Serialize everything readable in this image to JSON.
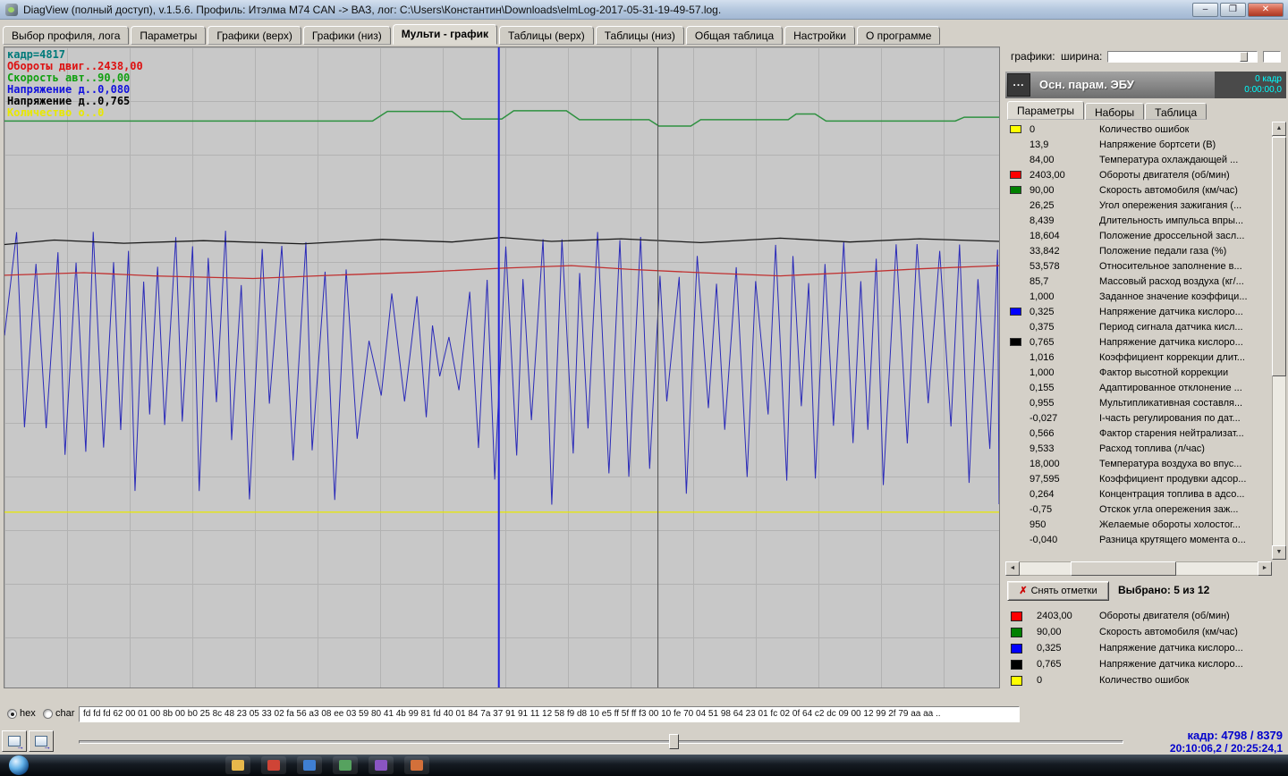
{
  "window": {
    "title": "DiagView (полный доступ), v.1.5.6. Профиль: Итэлма М74 CAN -> ВАЗ,  лог: C:\\Users\\Константин\\Downloads\\elmLog-2017-05-31-19-49-57.log.",
    "controls": {
      "minimize": "–",
      "maximize": "❐",
      "close": "✕"
    }
  },
  "icons": {
    "clear_x": "✗",
    "up": "▲",
    "down": "▼",
    "left": "◄",
    "right": "►"
  },
  "tabs": {
    "active_index": 4,
    "items": [
      "Выбор профиля, лога",
      "Параметры",
      "Графики (верх)",
      "Графики (низ)",
      "Мульти - график",
      "Таблицы (верх)",
      "Таблицы (низ)",
      "Общая таблица",
      "Настройки",
      "О программе"
    ]
  },
  "chart": {
    "legend": [
      {
        "text": "кадр=4817",
        "color": "#007a7a"
      },
      {
        "text": "Обороты двиг..2438,00",
        "color": "#dd1111"
      },
      {
        "text": "Скорость авт..90,00",
        "color": "#11a011"
      },
      {
        "text": "Напряжение д..0,080",
        "color": "#1111dd"
      },
      {
        "text": "Напряжение д..0,765",
        "color": "#000000"
      },
      {
        "text": "Количество о..0",
        "color": "#e8e800"
      }
    ],
    "colors": {
      "blue": "#2a2ab8",
      "red": "#c03030",
      "green": "#2e9140",
      "black": "#1a1a1a",
      "yellow": "#e8e800"
    },
    "series": {
      "green": [
        [
          0,
          0.115
        ],
        [
          0.37,
          0.115
        ],
        [
          0.385,
          0.1
        ],
        [
          0.45,
          0.1
        ],
        [
          0.46,
          0.112
        ],
        [
          0.5,
          0.112
        ],
        [
          0.512,
          0.099
        ],
        [
          0.565,
          0.099
        ],
        [
          0.578,
          0.113
        ],
        [
          0.648,
          0.113
        ],
        [
          0.658,
          0.123
        ],
        [
          0.69,
          0.123
        ],
        [
          0.7,
          0.113
        ],
        [
          0.788,
          0.113
        ],
        [
          0.796,
          0.104
        ],
        [
          0.815,
          0.104
        ],
        [
          0.826,
          0.115
        ],
        [
          0.956,
          0.115
        ],
        [
          0.965,
          0.109
        ],
        [
          1,
          0.109
        ]
      ],
      "black": [
        [
          0,
          0.308
        ],
        [
          0.05,
          0.301
        ],
        [
          0.12,
          0.306
        ],
        [
          0.2,
          0.302
        ],
        [
          0.3,
          0.307
        ],
        [
          0.38,
          0.3
        ],
        [
          0.45,
          0.304
        ],
        [
          0.5,
          0.297
        ],
        [
          0.55,
          0.303
        ],
        [
          0.62,
          0.299
        ],
        [
          0.7,
          0.305
        ],
        [
          0.78,
          0.298
        ],
        [
          0.85,
          0.304
        ],
        [
          0.92,
          0.299
        ],
        [
          1,
          0.303
        ]
      ],
      "red": [
        [
          0,
          0.356
        ],
        [
          0.08,
          0.352
        ],
        [
          0.15,
          0.357
        ],
        [
          0.25,
          0.361
        ],
        [
          0.33,
          0.356
        ],
        [
          0.42,
          0.351
        ],
        [
          0.5,
          0.345
        ],
        [
          0.57,
          0.341
        ],
        [
          0.63,
          0.347
        ],
        [
          0.7,
          0.352
        ],
        [
          0.78,
          0.357
        ],
        [
          0.85,
          0.352
        ],
        [
          0.92,
          0.346
        ],
        [
          1,
          0.341
        ]
      ],
      "yellow": [
        [
          0,
          0.726
        ],
        [
          1,
          0.726
        ]
      ]
    },
    "blue_gen": {
      "seed": 20170531,
      "x_step_min": 0.006,
      "x_step_rand": 0.007,
      "top_min": 0.285,
      "top_rand": 0.09,
      "bot_min": 0.545,
      "bot_rand": 0.17,
      "calm_start": 0.36,
      "calm_end": 0.47,
      "calm_top_shift": 0.09,
      "calm_bot_shift": -0.06
    },
    "cursors": [
      {
        "x": 0.497,
        "color": "#2020dd",
        "width": 2
      },
      {
        "x": 0.657,
        "color": "#505050",
        "width": 1
      }
    ]
  },
  "right_panel": {
    "width_label": "графики:",
    "width_label2": "ширина:",
    "header": {
      "menu_button": "...",
      "title": "Осн. парам. ЭБУ",
      "frame_text": "0 кадр",
      "time_text": "0:00:00,0"
    },
    "tabs": {
      "active_index": 0,
      "items": [
        "Параметры",
        "Наборы",
        "Таблица"
      ]
    },
    "params": [
      {
        "color": "#ffff00",
        "value": "0",
        "label": "Количество ошибок"
      },
      {
        "value": "13,9",
        "label": "Напряжение бортсети (В)"
      },
      {
        "value": "84,00",
        "label": "Температура охлаждающей ..."
      },
      {
        "color": "#ff0000",
        "value": "2403,00",
        "label": "Обороты двигателя (об/мин)"
      },
      {
        "color": "#008000",
        "value": "90,00",
        "label": "Скорость автомобиля (км/час)"
      },
      {
        "value": "26,25",
        "label": "Угол опережения зажигания (..."
      },
      {
        "value": "8,439",
        "label": "Длительность импульса впры..."
      },
      {
        "value": "18,604",
        "label": "Положение дроссельной засл..."
      },
      {
        "value": "33,842",
        "label": "Положение педали газа (%)"
      },
      {
        "value": "53,578",
        "label": "Относительное заполнение в..."
      },
      {
        "value": "85,7",
        "label": "Массовый расход воздуха (кг/..."
      },
      {
        "value": "1,000",
        "label": "Заданное значение коэффици..."
      },
      {
        "color": "#0000ff",
        "value": "0,325",
        "label": "Напряжение датчика кислоро..."
      },
      {
        "value": "0,375",
        "label": "Период сигнала датчика кисл..."
      },
      {
        "color": "#000000",
        "value": "0,765",
        "label": "Напряжение датчика кислоро..."
      },
      {
        "value": "1,016",
        "label": "Коэффициент коррекции длит..."
      },
      {
        "value": "1,000",
        "label": "Фактор высотной коррекции"
      },
      {
        "value": "0,155",
        "label": "Адаптированное отклонение ..."
      },
      {
        "value": "0,955",
        "label": "Мультипликативная составля..."
      },
      {
        "value": "-0,027",
        "label": "I-часть регулирования по дат..."
      },
      {
        "value": "0,566",
        "label": "Фактор старения нейтрализат..."
      },
      {
        "value": "9,533",
        "label": "Расход топлива (л/час)"
      },
      {
        "value": "18,000",
        "label": "Температура воздуха во впус..."
      },
      {
        "value": "97,595",
        "label": "Коэффициент продувки адсор..."
      },
      {
        "value": "0,264",
        "label": "Концентрация топлива в адсо..."
      },
      {
        "value": "-0,75",
        "label": "Отскок угла опережения заж..."
      },
      {
        "value": "950",
        "label": "Желаемые обороты холостог..."
      },
      {
        "value": "-0,040",
        "label": "Разница крутящего момента о..."
      }
    ],
    "clear_button_label": "Снять отметки",
    "selected_label": "Выбрано: 5 из 12",
    "selected": [
      {
        "color": "#ff0000",
        "value": "2403,00",
        "label": "Обороты двигателя (об/мин)"
      },
      {
        "color": "#008000",
        "value": "90,00",
        "label": "Скорость автомобиля (км/час)"
      },
      {
        "color": "#0000ff",
        "value": "0,325",
        "label": "Напряжение датчика кислоро..."
      },
      {
        "color": "#000000",
        "value": "0,765",
        "label": "Напряжение датчика кислоро..."
      },
      {
        "color": "#ffff00",
        "value": "0",
        "label": "Количество ошибок"
      }
    ]
  },
  "bottom": {
    "radio_hex_label": "hex",
    "radio_char_label": "char",
    "hex_string": "fd fd fd 62 00 01 00 8b 00 b0 25 8c 48 23 05 33 02 fa 56 a3 08 ee 03 59 80 41 4b 99 81 fd 40 01 84 7a 37 91 91 11 12 58 f9 d8 10 e5 ff 5f ff f3 00 10 fe 70 04 51 98 64 23 01 fc 02 0f 64 c2 dc 09 00 12 99 2f 79 aa aa ..",
    "frame_text": "кадр: 4798 / 8379",
    "time_text": "20:10:06,2 / 20:25:24,1"
  },
  "taskbar": {
    "icon_colors": [
      "#e8b84b",
      "#cf4436",
      "#3f7fd2",
      "#56a25f",
      "#8a55c2",
      "#d3703a"
    ]
  }
}
